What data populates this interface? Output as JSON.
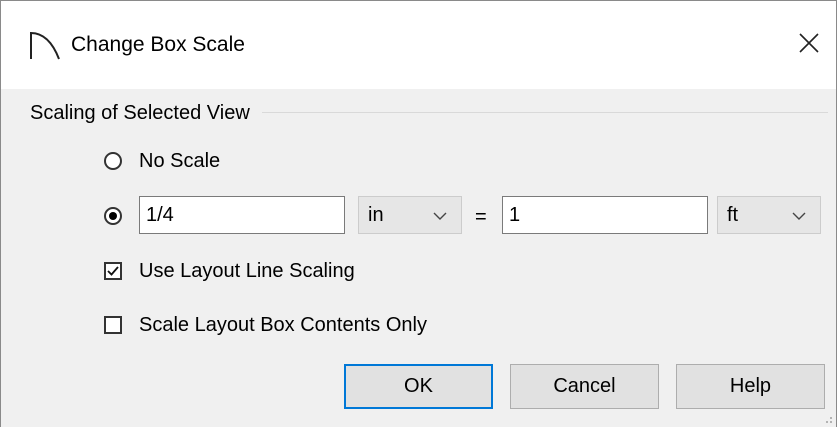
{
  "window": {
    "title": "Change Box Scale",
    "icon": "arc-icon",
    "close_glyph": "✕"
  },
  "group": {
    "label": "Scaling of Selected View"
  },
  "options": {
    "no_scale_label": "No Scale",
    "scale_selected": true
  },
  "scale": {
    "paper_value": "1/4",
    "paper_unit": "in",
    "equals": "=",
    "model_value": "1",
    "model_unit": "ft"
  },
  "checkboxes": {
    "use_layout_line_scaling": {
      "label": "Use Layout Line Scaling",
      "checked": true
    },
    "scale_contents_only": {
      "label": "Scale Layout Box Contents Only",
      "checked": false
    }
  },
  "buttons": {
    "ok": "OK",
    "cancel": "Cancel",
    "help": "Help"
  },
  "colors": {
    "accent": "#0078d7",
    "dialog_bg": "#f0f0f0",
    "button_bg": "#e1e1e1"
  }
}
